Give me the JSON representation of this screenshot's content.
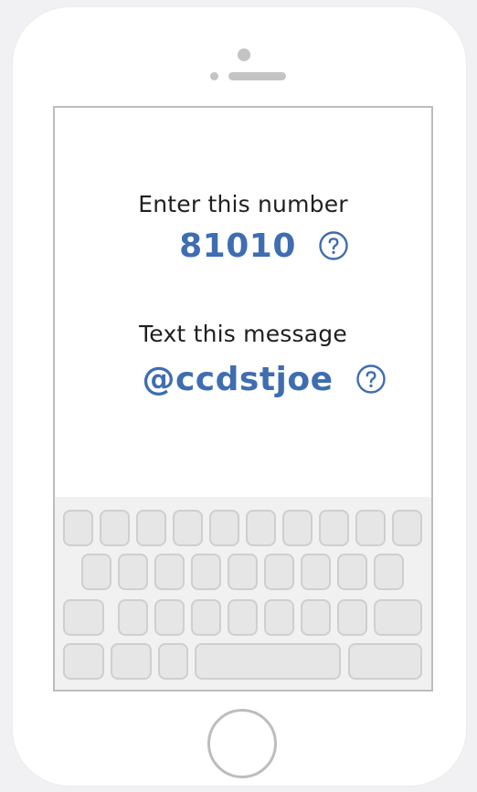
{
  "screen": {
    "step1": {
      "label": "Enter this number",
      "value": "81010"
    },
    "step2": {
      "label": "Text this message",
      "value": "@ccdstjoe"
    }
  },
  "icons": {
    "help": "question-circle-icon",
    "home": "home-button"
  },
  "colors": {
    "accent": "#3f6db1",
    "text": "#1f1f1f",
    "outline": "#bdbdbd",
    "key_fill": "#e6e6e6"
  }
}
